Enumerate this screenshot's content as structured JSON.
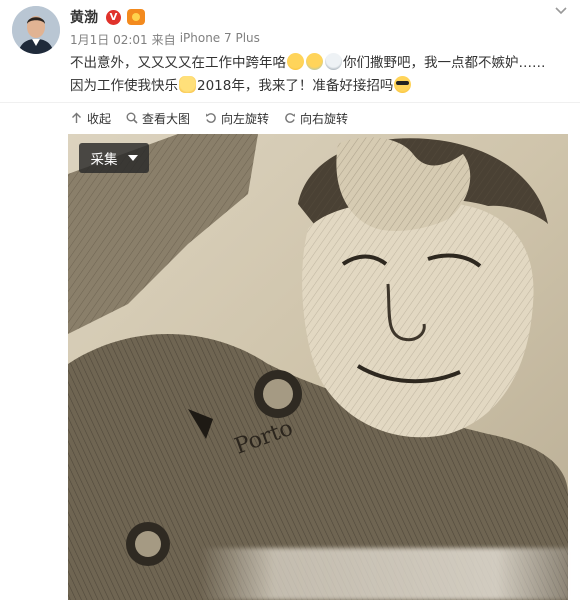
{
  "user": {
    "name": "黄渤",
    "verified_badge": "V",
    "medal_icon": "medal-icon"
  },
  "meta": {
    "time": "1月1日 02:01",
    "from_label": "来自",
    "device": "iPhone 7 Plus"
  },
  "post": {
    "line1_a": "不出意外，又又又又在工作中跨年咯",
    "line1_b": "你们撒野吧，我一点都不嫉妒……",
    "line2_a": "因为工作使我快乐",
    "line2_b": "2018年，我来了！准备好接招吗",
    "emojis": [
      "sad-face-emoji",
      "crying-face-emoji",
      "ghost-emoji",
      "cat-face-emoji",
      "sunglasses-emoji"
    ]
  },
  "toolbar": {
    "collapse": "收起",
    "view_large": "查看大图",
    "rotate_left": "向左旋转",
    "rotate_right": "向右旋转"
  },
  "image": {
    "collect_label": "采集"
  },
  "colors": {
    "verified": "#e0322b",
    "text": "#333333",
    "meta": "#808080",
    "photo_tone": "#d4cab3"
  }
}
